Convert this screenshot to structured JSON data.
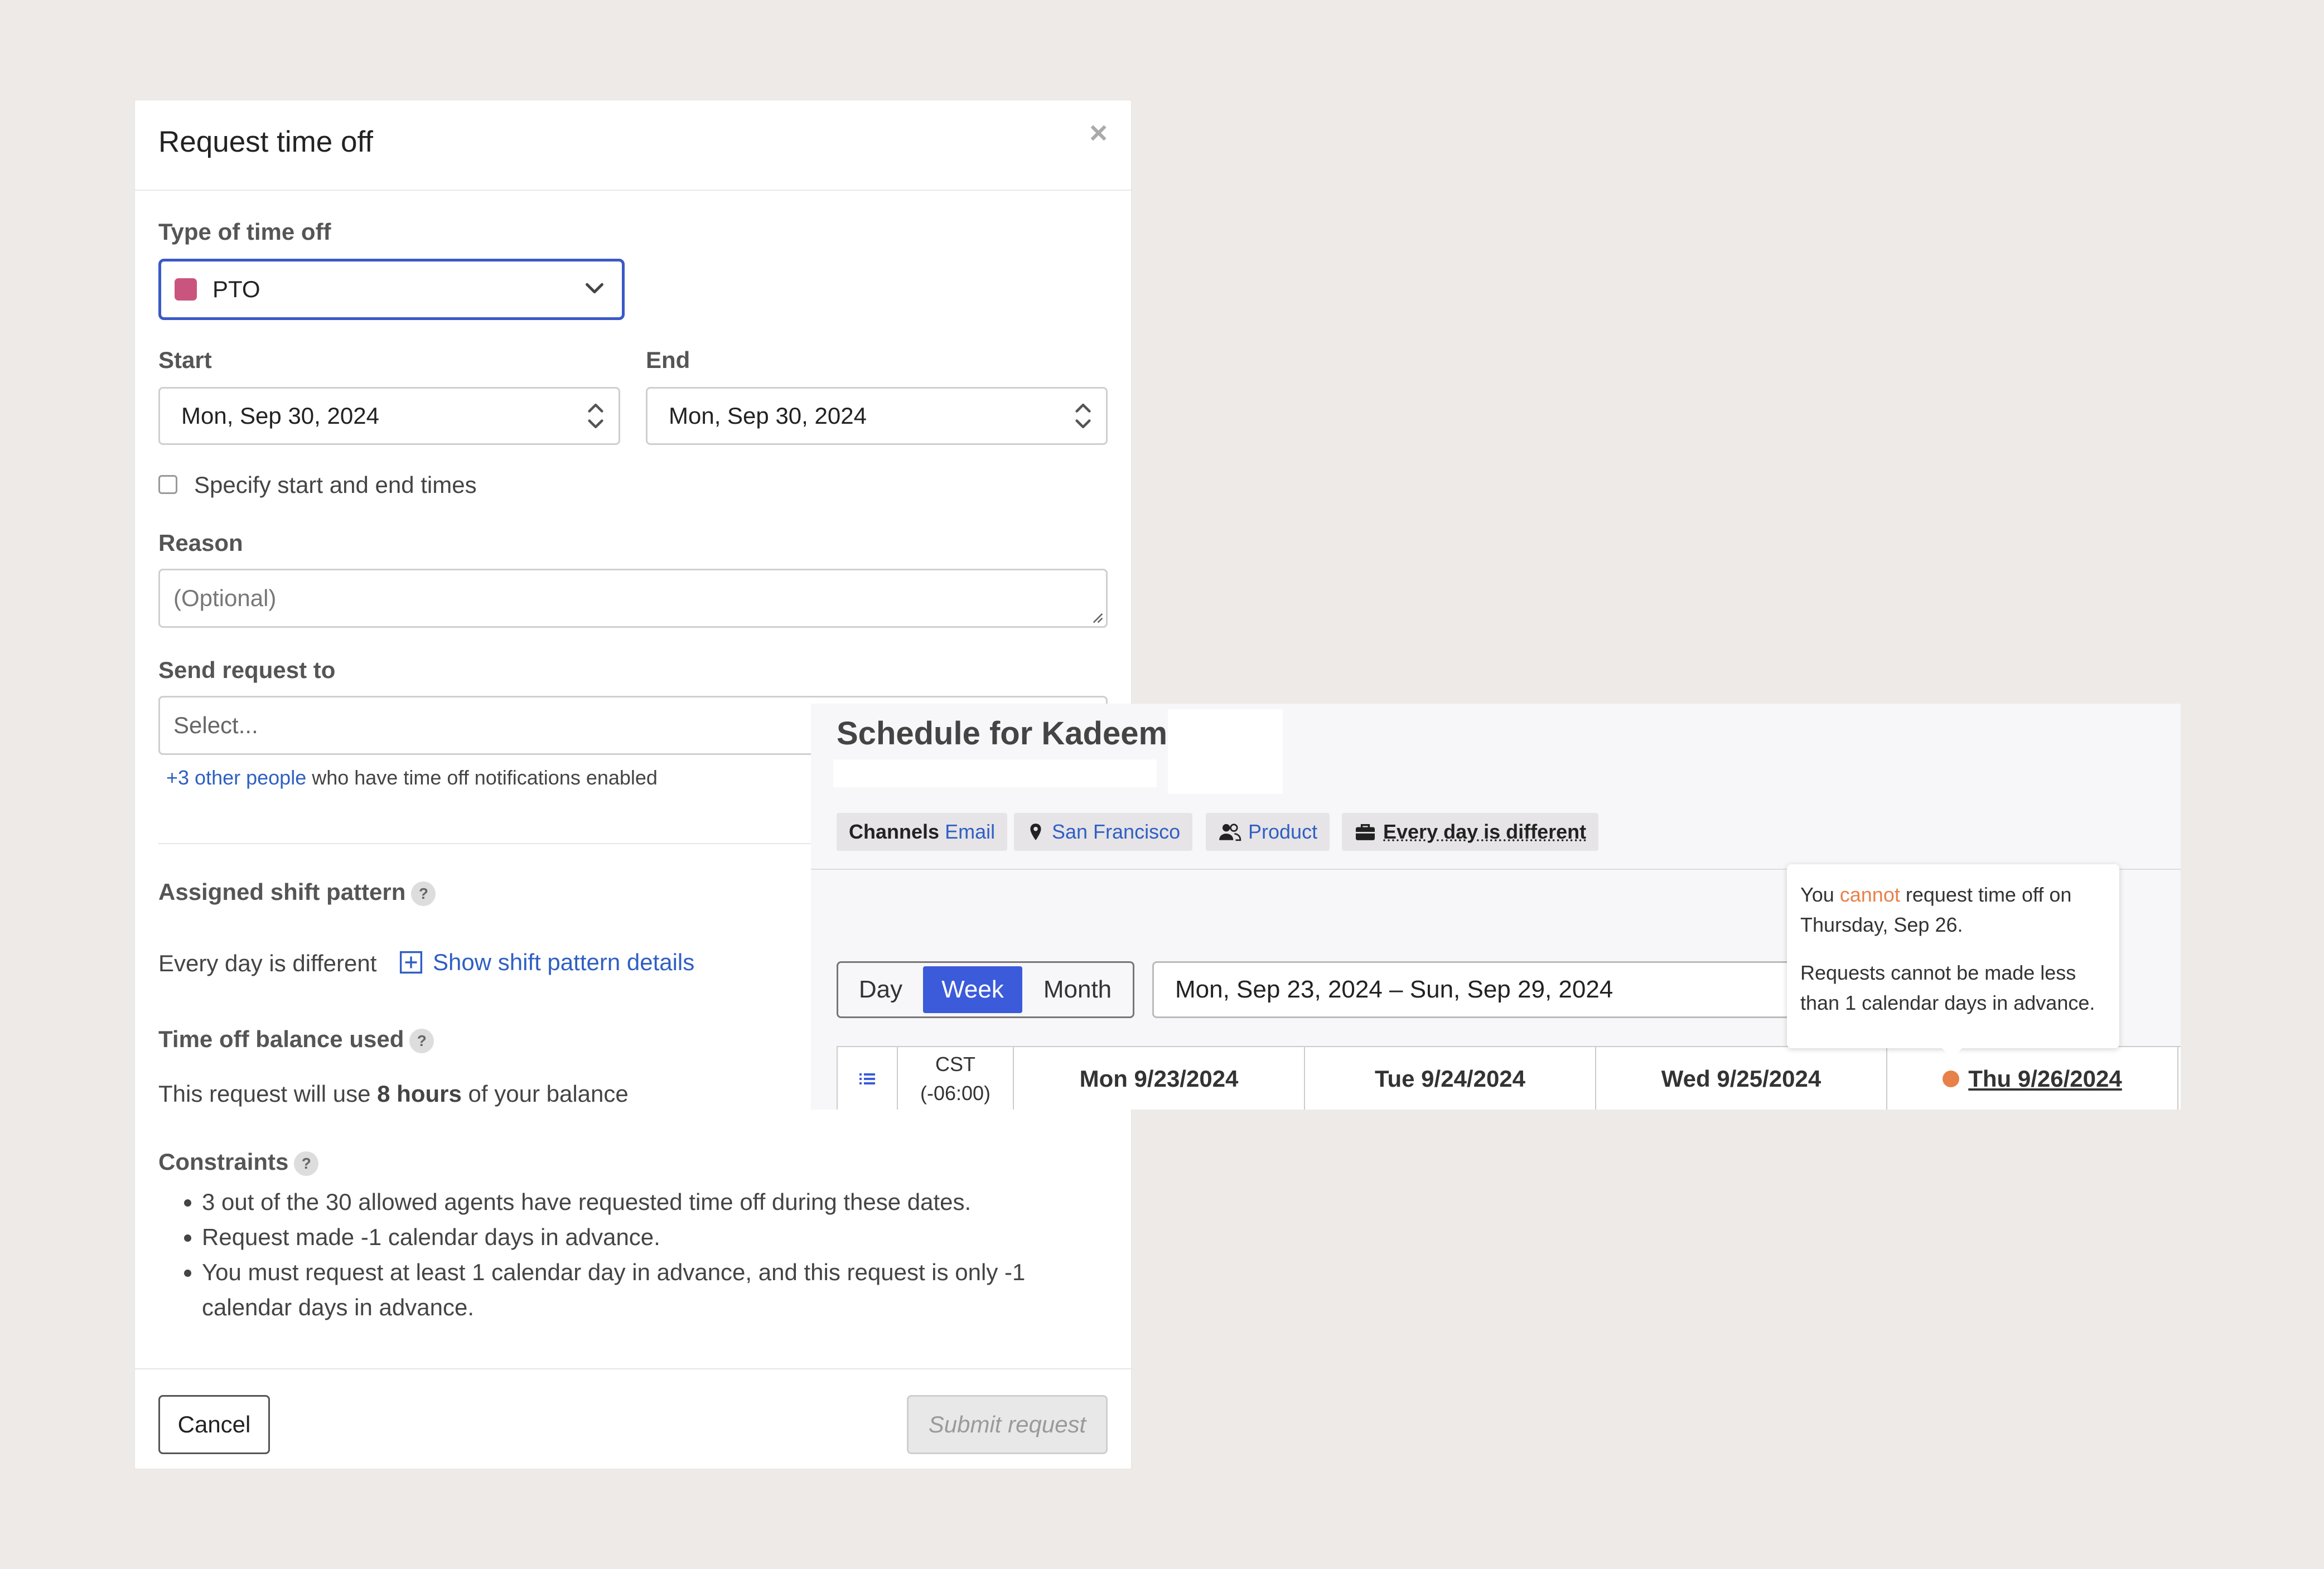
{
  "modal": {
    "title": "Request time off",
    "close": "×",
    "type_label": "Type of time off",
    "type_value": "PTO",
    "type_color": "#c9557f",
    "start_label": "Start",
    "start_value": "Mon, Sep 30, 2024",
    "end_label": "End",
    "end_value": "Mon, Sep 30, 2024",
    "specify_times_label": "Specify start and end times",
    "reason_label": "Reason",
    "reason_placeholder": "(Optional)",
    "send_to_label": "Send request to",
    "send_to_placeholder": "Select...",
    "others_link": "+3 other people",
    "others_text": " who have time off notifications enabled",
    "shift_pattern_label": "Assigned shift pattern",
    "shift_pattern_value": "Every day is different",
    "show_details_link": "Show shift pattern details",
    "balance_label": "Time off balance used",
    "balance_prefix": "This request will use ",
    "balance_amount": "8 hours",
    "balance_suffix": " of your balance",
    "constraints_label": "Constraints",
    "constraints": [
      "3 out of the 30 allowed agents have requested time off during these dates.",
      "Request made -1 calendar days in advance.",
      "You must request at least 1 calendar day in advance, and this request is only -1 calendar days in advance."
    ],
    "help": "?",
    "cancel": "Cancel",
    "submit": "Submit request"
  },
  "schedule": {
    "title": "Schedule for Kadeem",
    "chips": {
      "channels_label": "Channels",
      "channels_value": "Email",
      "location": "San Francisco",
      "team": "Product",
      "pattern": "Every day is different"
    },
    "views": [
      "Day",
      "Week",
      "Month"
    ],
    "active_view": "Week",
    "range": "Mon, Sep 23, 2024 – Sun, Sep 29, 2024",
    "timezone": [
      "CST",
      "(-06:00)"
    ],
    "days": [
      "Mon 9/23/2024",
      "Tue 9/24/2024",
      "Wed 9/25/2024",
      "Thu 9/26/2024"
    ],
    "accent": "#3b5bdb"
  },
  "tooltip": {
    "line1_prefix": "You ",
    "line1_highlight": "cannot",
    "line1_suffix": " request time off on Thursday, Sep 26.",
    "line2": "Requests cannot be made less than 1 calendar days in advance.",
    "highlight_color": "#e8804a"
  }
}
